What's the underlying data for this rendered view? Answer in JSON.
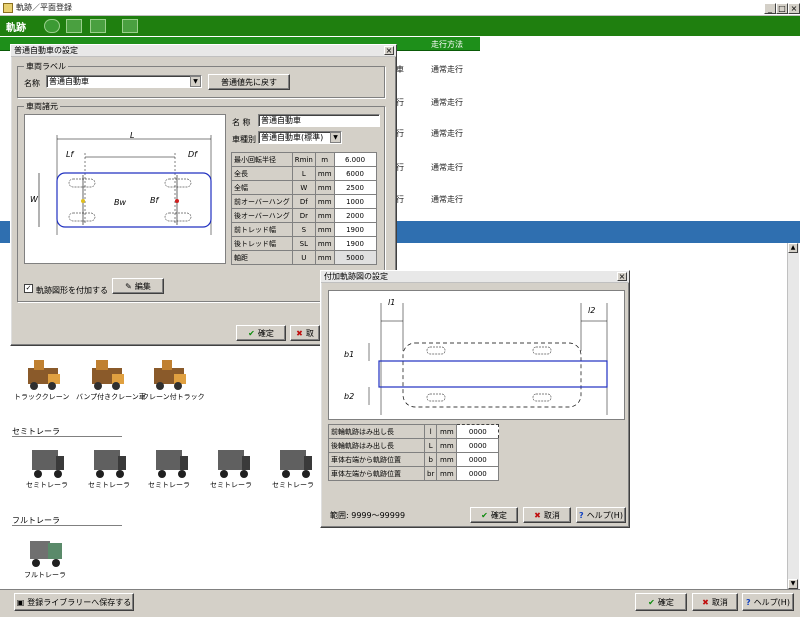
{
  "window": {
    "title": "軌跡／平面登録",
    "min": "_",
    "max": "□",
    "close": "×"
  },
  "toolbar": {
    "label": "軌跡"
  },
  "grid": {
    "headers": [
      "",
      "",
      "",
      "",
      "",
      "走行方法"
    ],
    "rows": [
      {
        "col5": "車",
        "method": "通常走行"
      },
      {
        "col5": "行",
        "method": "通常走行"
      },
      {
        "col5": "行",
        "method": "通常走行"
      },
      {
        "col5": "行",
        "method": "通常走行"
      },
      {
        "col5": "行",
        "method": "通常走行"
      }
    ]
  },
  "categories": [
    {
      "label": "",
      "items": [
        "トラッククレーン",
        "バンプ付きクレーン車",
        "クレーン付トラック"
      ]
    },
    {
      "label": "セミトレーラ",
      "items": [
        "セミトレーラ",
        "セミトレーラ",
        "セミトレーラ",
        "セミトレーラ",
        "セミトレーラ"
      ]
    },
    {
      "label": "フルトレーラ",
      "items": [
        "フルトレーラ"
      ]
    }
  ],
  "bottom": {
    "register_btn": "登録ライブラリーへ保存する",
    "ok": "確定",
    "cancel": "取消",
    "help": "ヘルプ(H)"
  },
  "dialog1": {
    "title": "普通自動車の設定",
    "group_vehicle": "車両ラベル",
    "name_label": "名称",
    "name_value": "普通自動車",
    "std_btn": "普通値先に戻す",
    "group_dims": "車両諸元",
    "field_name_label": "名 称",
    "field_name_value": "普通自動車",
    "kind_label": "車種別",
    "kind_value": "普通自動車(標準)",
    "diagram": {
      "L": "L",
      "W_label": "W",
      "Lf": "Lf",
      "Df": "Df",
      "Bw": "Bw",
      "Bf": "Bf",
      "Wb": "W"
    },
    "table": [
      {
        "name": "最小回転半径",
        "sym": "Rmin",
        "unit": "m",
        "value": "6.000"
      },
      {
        "name": "全長",
        "sym": "L",
        "unit": "mm",
        "value": "6000"
      },
      {
        "name": "全幅",
        "sym": "W",
        "unit": "mm",
        "value": "2500"
      },
      {
        "name": "前オーバーハング",
        "sym": "Df",
        "unit": "mm",
        "value": "1000"
      },
      {
        "name": "後オーバーハング",
        "sym": "Dr",
        "unit": "mm",
        "value": "2000"
      },
      {
        "name": "前トレッド幅",
        "sym": "S",
        "unit": "mm",
        "value": "1900"
      },
      {
        "name": "後トレッド幅",
        "sym": "SL",
        "unit": "mm",
        "value": "1900"
      },
      {
        "name": "軸距",
        "sym": "U",
        "unit": "mm",
        "value": "5000"
      }
    ],
    "check_label": "軌跡図形を付加する",
    "edit_btn": "編集",
    "ok": "確定",
    "cancel": "取"
  },
  "dialog2": {
    "title": "付加軌跡図の設定",
    "labels": {
      "l1": "l1",
      "l2": "l2",
      "b1": "b1",
      "b2": "b2"
    },
    "table": [
      {
        "name": "前輪軌跡はみ出し長",
        "sym": "l",
        "unit": "mm",
        "value": "0000"
      },
      {
        "name": "後輪軌跡はみ出し長",
        "sym": "L",
        "unit": "mm",
        "value": "0000"
      },
      {
        "name": "車体右端から軌跡位置",
        "sym": "b",
        "unit": "mm",
        "value": "0000"
      },
      {
        "name": "車体左端から軌跡位置",
        "sym": "br",
        "unit": "mm",
        "value": "0000"
      }
    ],
    "range": "範囲: 9999～99999",
    "ok": "確定",
    "cancel": "取消",
    "help": "ヘルプ(H)"
  }
}
